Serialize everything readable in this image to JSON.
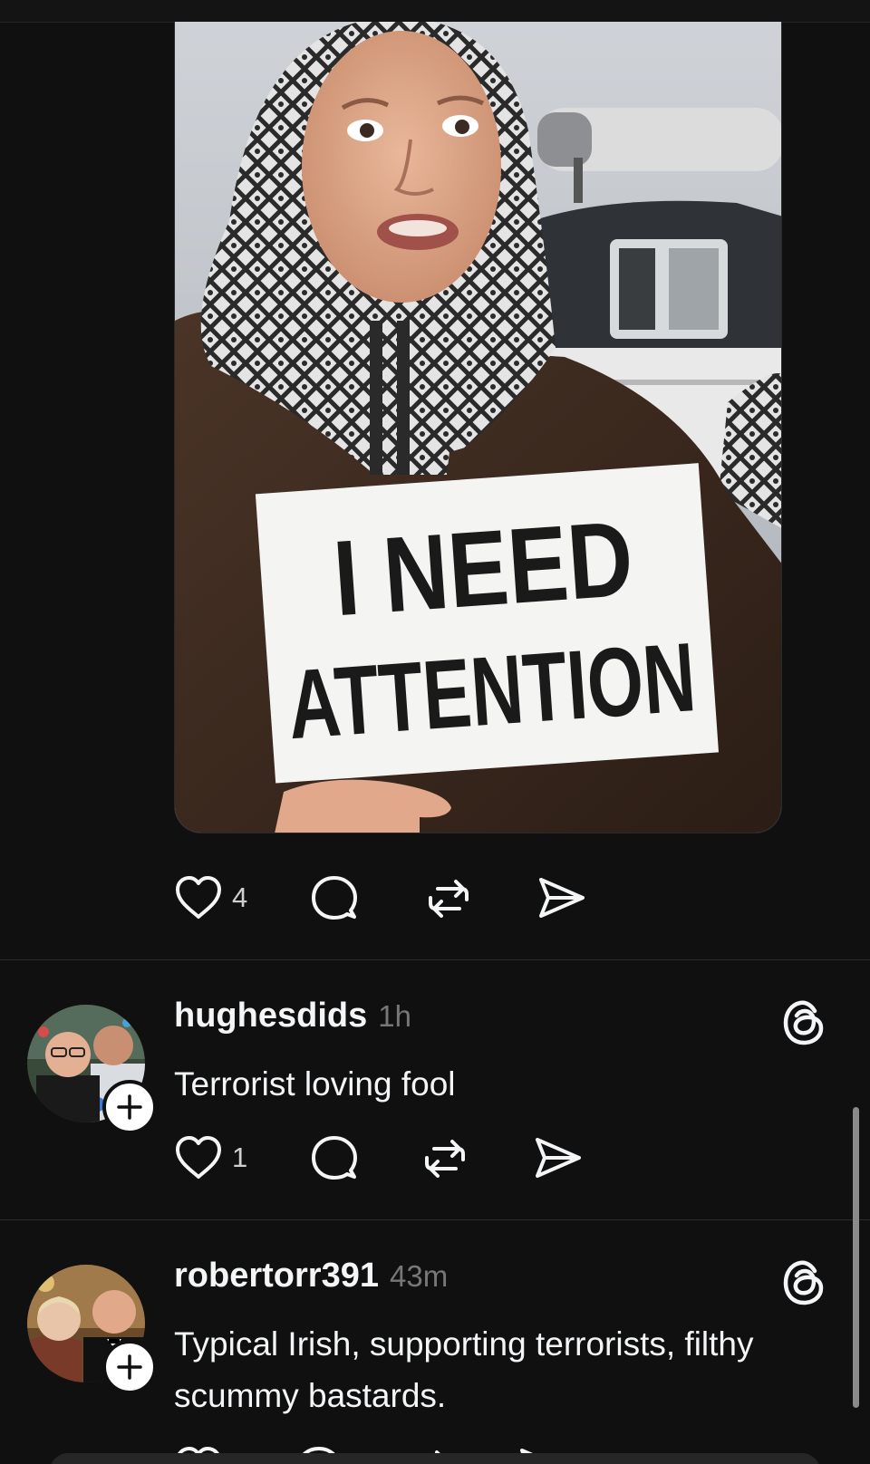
{
  "post": {
    "image": {
      "sign_line_1": "I NEED",
      "sign_line_2": "ATTENTION"
    },
    "actions": {
      "like_icon": "heart-icon",
      "like_count": "4",
      "reply_icon": "comment-icon",
      "repost_icon": "repost-icon",
      "share_icon": "send-icon"
    }
  },
  "replies": [
    {
      "username": "hughesdids",
      "time": "1h",
      "text": "Terrorist loving fool",
      "like_count": "1",
      "follow_icon": "plus-icon",
      "badge_icon": "threads-icon"
    },
    {
      "username": "robertorr391",
      "time": "43m",
      "text": "Typical Irish, supporting terrorists, filthy scummy bastards.",
      "follow_icon": "plus-icon",
      "badge_icon": "threads-icon"
    }
  ],
  "colors": {
    "background": "#101010",
    "text": "#f3f5f7",
    "muted": "#777777",
    "divider": "#2b2b2b"
  }
}
